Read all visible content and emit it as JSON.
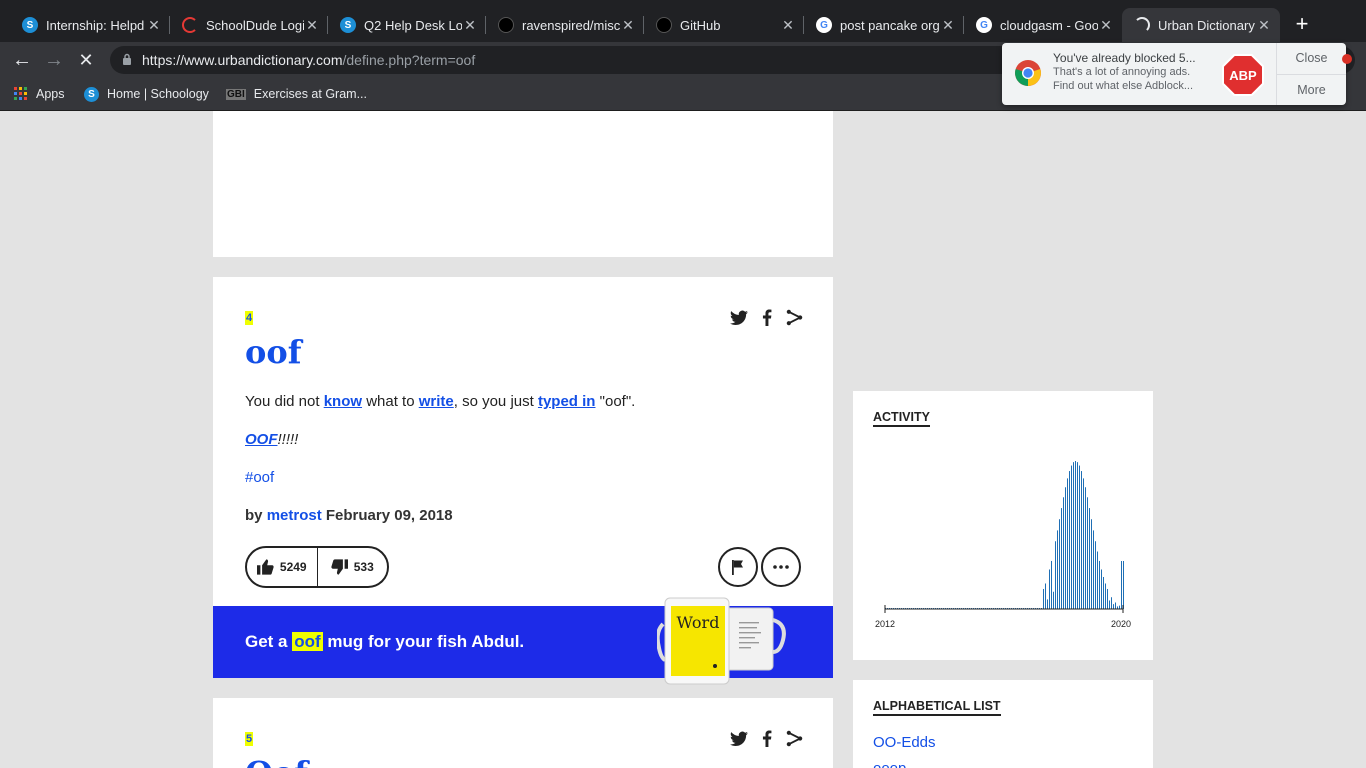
{
  "browser": {
    "tabs": [
      {
        "title": "Internship: Helpd",
        "icon": "schoology-icon"
      },
      {
        "title": "SchoolDude Logi",
        "icon": "schooldude-icon"
      },
      {
        "title": "Q2 Help Desk Lo",
        "icon": "schoology-icon"
      },
      {
        "title": "ravenspired/misc",
        "icon": "github-icon"
      },
      {
        "title": "GitHub",
        "icon": "github-icon"
      },
      {
        "title": "post pancake org",
        "icon": "google-icon"
      },
      {
        "title": "cloudgasm - Goo",
        "icon": "google-icon"
      },
      {
        "title": "Urban Dictionary",
        "icon": "loading-icon"
      }
    ],
    "url_host": "https://www.urbandictionary.com",
    "url_path": "/define.php?term=oof",
    "bookmarks": [
      {
        "label": "Apps",
        "icon": "apps-grid-icon"
      },
      {
        "label": "Home | Schoology",
        "icon": "schoology-icon"
      },
      {
        "label": "Exercises at Gram...",
        "icon": "gbi-icon"
      }
    ]
  },
  "abp_popup": {
    "line1": "You've already blocked 5...",
    "line2": "That's a lot of annoying ads.",
    "line3": "Find out what else Adblock...",
    "logo_text": "ABP",
    "close_label": "Close",
    "more_label": "More"
  },
  "definition": {
    "rank": "4",
    "word": "oof",
    "meaning_parts": {
      "p1": "You did not ",
      "link1": "know",
      "p2": " what to ",
      "link2": "write",
      "p3": ", so you just ",
      "link3": "typed in",
      "p4": " \"oof\"."
    },
    "example_link": "OOF",
    "example_rest": "!!!!!",
    "tag": "#oof",
    "by_label": "by",
    "author": "metrost",
    "date": "February 09, 2018",
    "upvotes": "5249",
    "downvotes": "533",
    "mug_pre": "Get a ",
    "mug_word": "oof",
    "mug_post": " mug for your fish Abdul.",
    "mug_label": "Word"
  },
  "next_definition": {
    "rank": "5",
    "word": "Oof"
  },
  "sidebar": {
    "activity_heading": "ACTIVITY",
    "year_start": "2012",
    "year_end": "2020",
    "alpha_heading": "ALPHABETICAL LIST",
    "alpha_items": [
      "OO-Edds",
      "ooop"
    ]
  },
  "colors": {
    "ud_blue": "#134fe6",
    "ud_yellow": "#efff00",
    "banner_blue": "#1d2be8"
  }
}
